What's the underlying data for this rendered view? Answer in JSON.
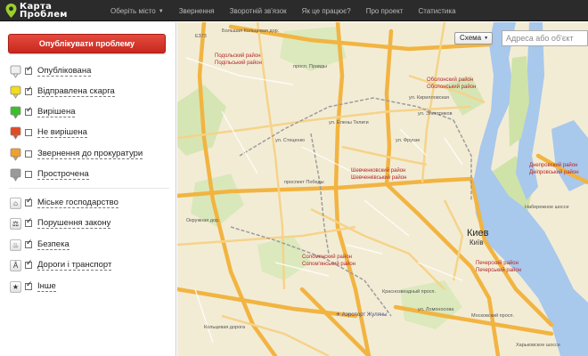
{
  "app": {
    "logo_line1": "Карта",
    "logo_line2": "Проблем"
  },
  "nav": [
    {
      "label": "Оберіть місто",
      "has_caret": true
    },
    {
      "label": "Звернення"
    },
    {
      "label": "Зворотній зв'язок"
    },
    {
      "label": "Як це працює?"
    },
    {
      "label": "Про проект"
    },
    {
      "label": "Статистика"
    }
  ],
  "sidebar": {
    "publish_label": "Опублікувати проблему",
    "status_filters": [
      {
        "label": "Опублікована",
        "checked": true,
        "icon": "white-marker-icon",
        "color": "#f0f0f0"
      },
      {
        "label": "Відправлена скарга",
        "checked": true,
        "icon": "yellow-marker-icon",
        "color": "#f2dc1c"
      },
      {
        "label": "Вирішена",
        "checked": true,
        "icon": "green-marker-icon",
        "color": "#3cbf2a"
      },
      {
        "label": "Не вирішена",
        "checked": false,
        "icon": "red-marker-icon",
        "color": "#e04a24"
      },
      {
        "label": "Звернення до прокуратури",
        "checked": false,
        "icon": "orange-marker-icon",
        "color": "#f0a030"
      },
      {
        "label": "Прострочена",
        "checked": false,
        "icon": "gray-marker-icon",
        "color": "#9a9a9a"
      }
    ],
    "category_filters": [
      {
        "label": "Міське господарство",
        "checked": true,
        "icon": "house-icon",
        "glyph": "⌂"
      },
      {
        "label": "Порушення закону",
        "checked": true,
        "icon": "gavel-icon",
        "glyph": "⚖"
      },
      {
        "label": "Безпека",
        "checked": true,
        "icon": "fire-icon",
        "glyph": "♨"
      },
      {
        "label": "Дороги і транспорт",
        "checked": true,
        "icon": "road-icon",
        "glyph": "Å"
      },
      {
        "label": "Інше",
        "checked": true,
        "icon": "star-icon",
        "glyph": "★"
      }
    ]
  },
  "map": {
    "scheme_label": "Схема",
    "search_placeholder": "Адреса або об'єкт",
    "city_label": "Киев",
    "city_label_ua": "Київ",
    "labels": [
      "Большая Кольцевая дор.",
      "Подольский район",
      "Подільський район",
      "просп. Правды",
      "Оболонский район",
      "Оболонський район",
      "ул. Кирилловская",
      "Шевченковский район",
      "Шевченківський район",
      "Соломенский район",
      "Солом'янський район",
      "Днепровский район",
      "Дніпровський район",
      "Печерский район",
      "Печерський район",
      "проспект Победы",
      "ул. Стеценко",
      "ул. Елены Телиги",
      "ул. Фрунзе",
      "ул. Электриков",
      "Набережное шоссе",
      "Краснозвездный просп.",
      "ул. Ломоносова",
      "Аэропорт Жуляны",
      "Кольцевая дорога",
      "Окружная дор.",
      "E373",
      "Московский просп.",
      "Харьковское шоссе"
    ]
  }
}
